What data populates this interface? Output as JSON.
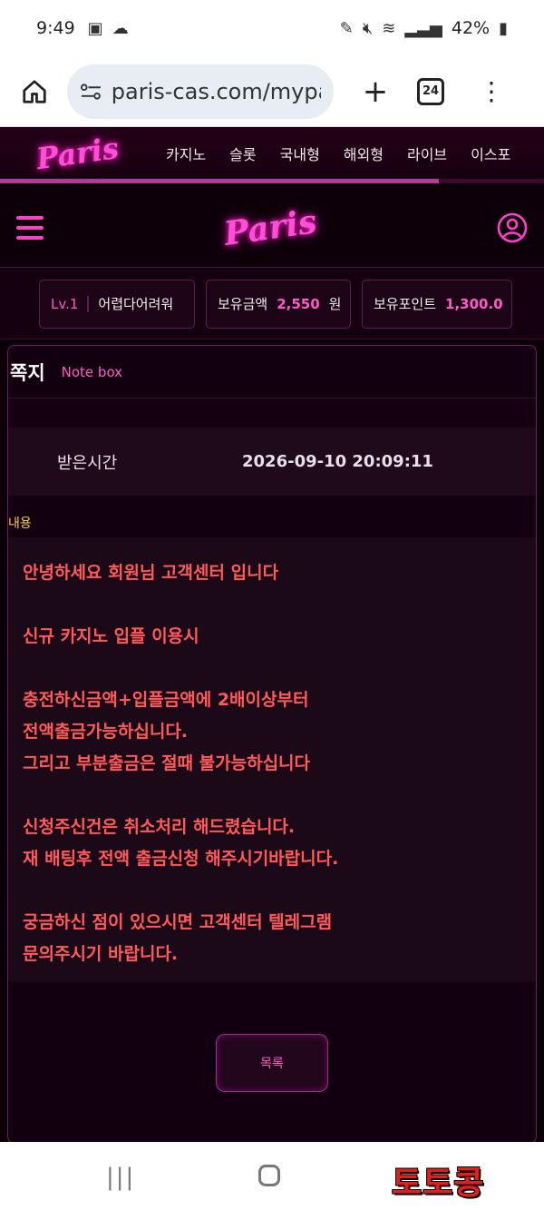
{
  "statusbar": {
    "time": "9:49",
    "battery": "42%"
  },
  "browser": {
    "url": "paris-cas.com/mypa",
    "tab_count": "24"
  },
  "site": {
    "logo": "Paris",
    "nav": [
      "카지노",
      "슬롯",
      "국내형",
      "해외형",
      "라이브",
      "이스포"
    ]
  },
  "user_bar": {
    "level": "Lv.1",
    "username": "어렵다어려워",
    "balance_label": "보유금액",
    "balance_value": "2,550",
    "balance_unit": "원",
    "points_label": "보유포인트",
    "points_value": "1,300.0"
  },
  "note": {
    "title": "쪽지",
    "subtitle": "Note box",
    "received_label": "받은시간",
    "received_value": "2026-09-10 20:09:11",
    "content_label": "내용",
    "lines": [
      "안녕하세요 회원님 고객센터 입니다",
      "",
      "신규 카지노 입플 이용시",
      "",
      "충전하신금액+입플금액에 2배이상부터",
      "전액출금가능하십니다.",
      "그리고 부분출금은 절때 불가능하십니다",
      "",
      "신청주신건은 취소처리 해드렸습니다.",
      "재 배팅후 전액 출금신청 해주시기바랍니다.",
      "",
      "궁금하신 점이 있으시면 고객센터 텔레그램",
      "문의주시기 바랍니다."
    ],
    "list_button": "목록"
  },
  "watermark": "토토콩",
  "colors": {
    "accent": "#ff5ac8",
    "content_text": "#ff5a5a",
    "label_yellow": "#ffcf3a"
  }
}
